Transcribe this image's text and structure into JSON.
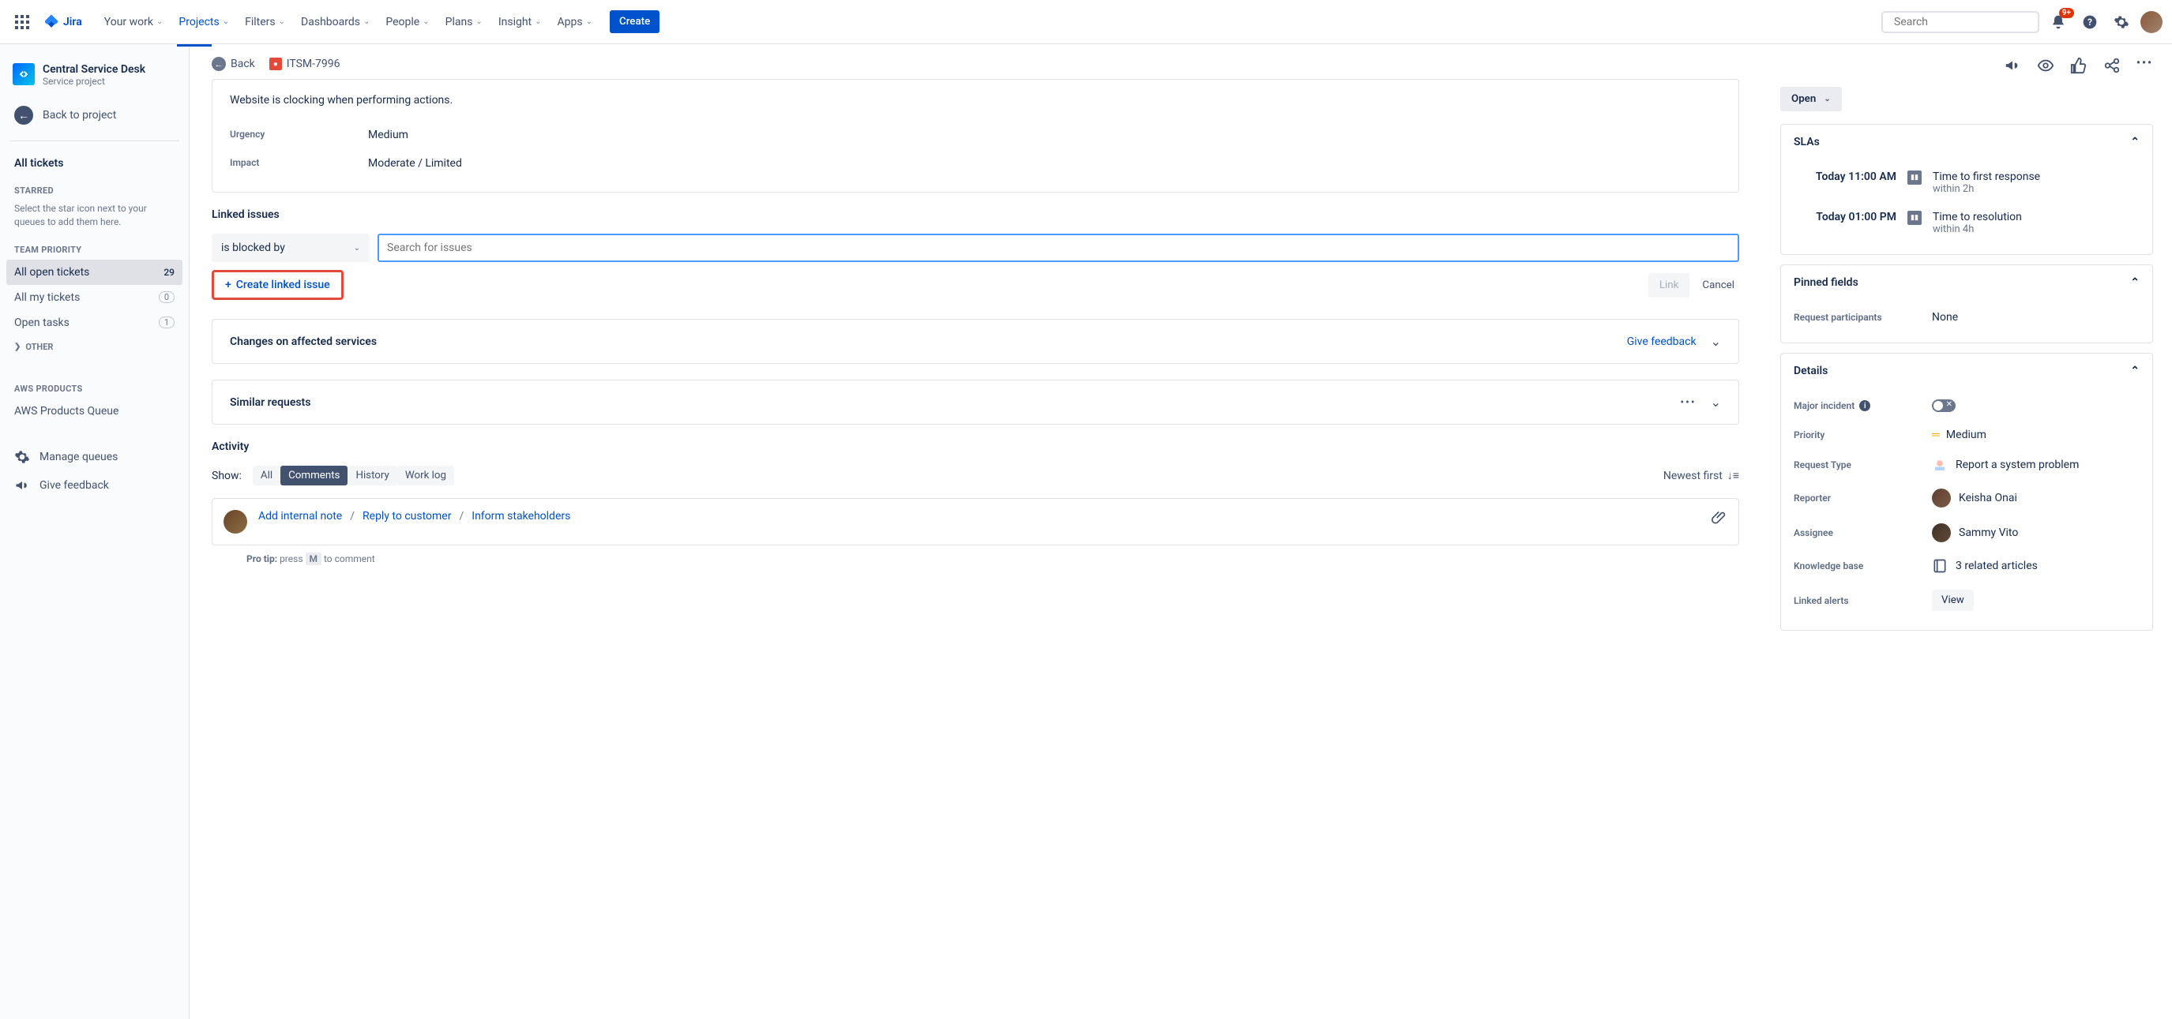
{
  "nav": {
    "logo": "Jira",
    "items": [
      "Your work",
      "Projects",
      "Filters",
      "Dashboards",
      "People",
      "Plans",
      "Insight",
      "Apps"
    ],
    "active_index": 1,
    "create": "Create",
    "search_placeholder": "Search",
    "notifications_badge": "9+"
  },
  "sidebar": {
    "project_name": "Central Service Desk",
    "project_type": "Service project",
    "back": "Back to project",
    "all_tickets": "All tickets",
    "starred_heading": "STARRED",
    "starred_hint": "Select the star icon next to your queues to add them here.",
    "team_heading": "TEAM PRIORITY",
    "queues": [
      {
        "label": "All open tickets",
        "count": "29",
        "selected": true
      },
      {
        "label": "All my tickets",
        "count": "0",
        "selected": false
      },
      {
        "label": "Open tasks",
        "count": "1",
        "selected": false
      }
    ],
    "other": "OTHER",
    "aws_heading": "AWS PRODUCTS",
    "aws_queue": "AWS Products Queue",
    "manage": "Manage queues",
    "feedback": "Give feedback"
  },
  "crumb": {
    "back": "Back",
    "key": "ITSM-7996"
  },
  "summary": {
    "description": "Website is clocking when performing actions.",
    "urgency_label": "Urgency",
    "urgency_val": "Medium",
    "impact_label": "Impact",
    "impact_val": "Moderate / Limited"
  },
  "linked": {
    "heading": "Linked issues",
    "type": "is blocked by",
    "search_placeholder": "Search for issues",
    "create": "Create linked issue",
    "link": "Link",
    "cancel": "Cancel"
  },
  "changes": {
    "heading": "Changes on affected services",
    "feedback": "Give feedback"
  },
  "similar": {
    "heading": "Similar requests"
  },
  "activity": {
    "heading": "Activity",
    "show": "Show:",
    "tabs": [
      "All",
      "Comments",
      "History",
      "Work log"
    ],
    "active_tab": 1,
    "sort": "Newest first",
    "internal": "Add internal note",
    "reply": "Reply to customer",
    "inform": "Inform stakeholders",
    "protip_label": "Pro tip:",
    "protip_a": "press",
    "protip_key": "M",
    "protip_b": "to comment"
  },
  "pane": {
    "status": "Open",
    "slas_heading": "SLAs",
    "slas": [
      {
        "time": "Today 11:00 AM",
        "title": "Time to first response",
        "sub": "within 2h"
      },
      {
        "time": "Today 01:00 PM",
        "title": "Time to resolution",
        "sub": "within 4h"
      }
    ],
    "pinned_heading": "Pinned fields",
    "pinned_label": "Request participants",
    "pinned_val": "None",
    "details_heading": "Details",
    "major_label": "Major incident",
    "priority_label": "Priority",
    "priority_val": "Medium",
    "reqtype_label": "Request Type",
    "reqtype_val": "Report a system problem",
    "reporter_label": "Reporter",
    "reporter_val": "Keisha Onai",
    "assignee_label": "Assignee",
    "assignee_val": "Sammy Vito",
    "kb_label": "Knowledge base",
    "kb_val": "3 related articles",
    "alerts_label": "Linked alerts",
    "alerts_val": "View"
  }
}
